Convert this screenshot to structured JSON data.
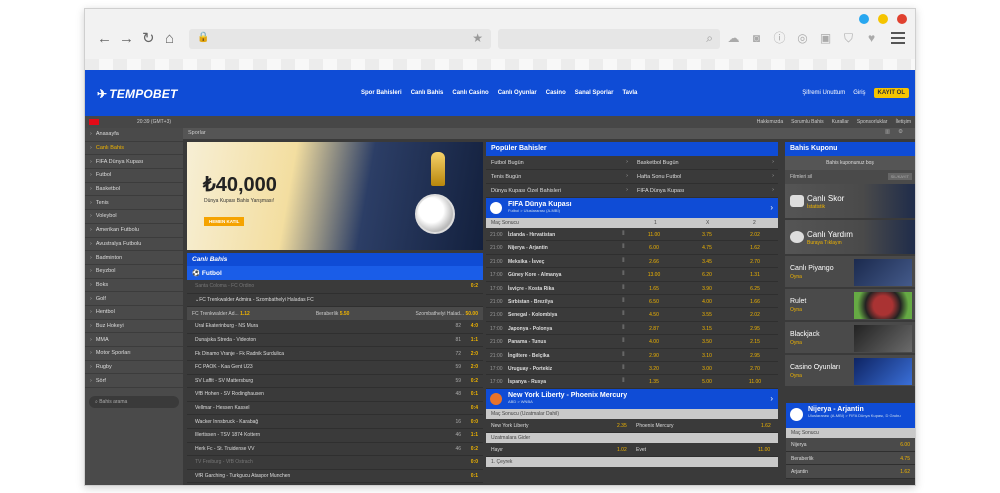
{
  "browser": {
    "dot_colors": [
      "#28a7f0",
      "#f5c400",
      "#e0412f"
    ]
  },
  "header": {
    "logo": "TEMPOBET",
    "nav": [
      "Spor Bahisleri",
      "Canlı Bahis",
      "Canlı Casino",
      "Canlı Oyunlar",
      "Casino",
      "Sanal Sporlar",
      "Tavla"
    ],
    "forgot": "Şifremi Unuttum",
    "login": "Giriş",
    "register": "KAYIT OL"
  },
  "topbar": {
    "clock": "20:39 (GMT+3)",
    "links": [
      "Hakkımızda",
      "Sorumlu Bahis",
      "Kurallar",
      "Sponsorluklar",
      "İletişim"
    ]
  },
  "sidebar": {
    "items": [
      "Anasayfa",
      "Canlı Bahis",
      "FIFA Dünya Kupası",
      "Futbol",
      "Basketbol",
      "Tenis",
      "Voleybol",
      "Amerikan Futbolu",
      "Avustralya Futbolu",
      "Badminton",
      "Beyzbol",
      "Boks",
      "Golf",
      "Hentbol",
      "Buz Hokeyi",
      "MMA",
      "Motor Sporları",
      "Rugby",
      "Sörf"
    ],
    "search_placeholder": "Bahis arama"
  },
  "crumb": "Sporlar",
  "banner": {
    "amount": "₺40,000",
    "subtitle": "Dünya Kupası Bahis Yarışması!",
    "button": "HEMEN KATIL"
  },
  "live": {
    "title": "Canlı Bahis",
    "sport": "Futbol",
    "featured": {
      "name": "FC Trenkwalder Admira - Szombathelyi Haladas FC"
    },
    "odds": {
      "home": "FC Trenkwalder Ad...",
      "home_odd": "1.12",
      "draw": "Beraberlik",
      "draw_odd": "5.50",
      "away": "Szombathelyi Halad...",
      "away_odd": "50.00"
    },
    "matches": [
      {
        "name": "Santa Coloma - FC Ordino",
        "time": "",
        "score": "0:2",
        "dim": true
      },
      {
        "name": "Ural Ekaterinburg - NS Mura",
        "time": "82",
        "score": "4:0"
      },
      {
        "name": "Dunajska Streda - Videoton",
        "time": "81",
        "score": "1:1"
      },
      {
        "name": "Fk Dinamo Vranje - Fk Radnik Surdulica",
        "time": "72",
        "score": "2:0"
      },
      {
        "name": "FC PAOK - Kaa Gent U23",
        "time": "59",
        "score": "2:0"
      },
      {
        "name": "SV Laffit - SV Mattersburg",
        "time": "59",
        "score": "0:2"
      },
      {
        "name": "VfB Hohen - SV Rodinghausen",
        "time": "48",
        "score": "0:1"
      },
      {
        "name": "Vellmar - Hessen Kassel",
        "time": "",
        "score": "0:4"
      },
      {
        "name": "Wacker Innsbruck - Karabağ",
        "time": "16",
        "score": "0:0"
      },
      {
        "name": "Illertissen - TSV 1874 Kottern",
        "time": "46",
        "score": "1:1"
      },
      {
        "name": "Herk Fc - St. Truidense VV",
        "time": "46",
        "score": "0:2"
      },
      {
        "name": "TV Freiburg - VfB Ostrach",
        "time": "",
        "score": "0:0",
        "dim": true
      },
      {
        "name": "VfR Garching - Turkgucu Ataspor Munchen",
        "time": "",
        "score": "0:1"
      }
    ]
  },
  "popular": {
    "title": "Popüler Bahisler",
    "items": [
      "Futbol Bugün",
      "Basketbol Bugün",
      "Tenis Bugün",
      "Hafta Sonu Futbol",
      "Dünya Kupası Özel Bahisleri",
      "FIFA Dünya Kupası"
    ]
  },
  "fifa": {
    "title": "FIFA Dünya Kupası",
    "subtitle": "Futbol > Uluslararası (A-MBİ)",
    "market": "Maç Sonucu",
    "cols": [
      "1",
      "X",
      "2"
    ],
    "matches": [
      {
        "time": "21:00",
        "name": "İzlanda - Hırvatistan",
        "o1": "11.00",
        "ox": "3.75",
        "o2": "2.02"
      },
      {
        "time": "21:00",
        "name": "Nijerya - Arjantin",
        "o1": "6.00",
        "ox": "4.75",
        "o2": "1.62"
      },
      {
        "time": "21:00",
        "name": "Meksika - İsveç",
        "o1": "2.66",
        "ox": "3.45",
        "o2": "2.70"
      },
      {
        "time": "17:00",
        "name": "Güney Kore - Almanya",
        "o1": "13.00",
        "ox": "6.20",
        "o2": "1.31"
      },
      {
        "time": "17:00",
        "name": "İsviçre - Kosta Rika",
        "o1": "1.65",
        "ox": "3.90",
        "o2": "6.25"
      },
      {
        "time": "21:00",
        "name": "Sırbistan - Brezilya",
        "o1": "6.50",
        "ox": "4.00",
        "o2": "1.66"
      },
      {
        "time": "21:00",
        "name": "Senegal - Kolombiya",
        "o1": "4.50",
        "ox": "3.55",
        "o2": "2.02"
      },
      {
        "time": "17:00",
        "name": "Japonya - Polonya",
        "o1": "2.87",
        "ox": "3.15",
        "o2": "2.95"
      },
      {
        "time": "21:00",
        "name": "Panama - Tunus",
        "o1": "4.00",
        "ox": "3.50",
        "o2": "2.15"
      },
      {
        "time": "21:00",
        "name": "İngiltere - Belçika",
        "o1": "2.90",
        "ox": "3.10",
        "o2": "2.95"
      },
      {
        "time": "17:00",
        "name": "Uruguay - Portekiz",
        "o1": "3.20",
        "ox": "3.00",
        "o2": "2.70"
      },
      {
        "time": "17:00",
        "name": "İspanya - Rusya",
        "o1": "1.35",
        "ox": "5.00",
        "o2": "11.00"
      }
    ]
  },
  "wnba": {
    "title": "New York Liberty - Phoenix Mercury",
    "subtitle": "ABD > WNBA",
    "market1": "Maç Sonucu (Uzatmalar Dahil)",
    "home": "New York Liberty",
    "home_odd": "2.35",
    "away": "Phoenix Mercury",
    "away_odd": "1.62",
    "market2": "Uzatmalara Gider",
    "no": "Hayır",
    "no_odd": "1.02",
    "yes": "Evet",
    "yes_odd": "11.00",
    "market3": "1. Çeyrek"
  },
  "coupon": {
    "title": "Bahis Kuponu",
    "empty": "Bahis kuponunuz boş",
    "filter": "Filmleri sil",
    "delete": "SİL/KAYIT"
  },
  "promos": [
    {
      "title": "Canlı Skor",
      "sub": "İstatistik"
    },
    {
      "title": "Canlı Yardım",
      "sub": "Buraya Tıklayın"
    }
  ],
  "games": [
    {
      "title": "Canlı Piyango",
      "sub": "Oyna"
    },
    {
      "title": "Rulet",
      "sub": "Oyna"
    },
    {
      "title": "Blackjack",
      "sub": "Oyna"
    },
    {
      "title": "Casino Oyunları",
      "sub": "Oyna"
    }
  ],
  "minimatch": {
    "title": "Nijerya - Arjantin",
    "subtitle": "Uluslararası (A-MBİ) > FIFA Dünya Kupası, D Grubu",
    "market": "Maç Sonucu",
    "rows": [
      {
        "name": "Nijerya",
        "odd": "6.00"
      },
      {
        "name": "Beraberlik",
        "odd": "4.75"
      },
      {
        "name": "Arjantin",
        "odd": "1.62"
      }
    ]
  }
}
